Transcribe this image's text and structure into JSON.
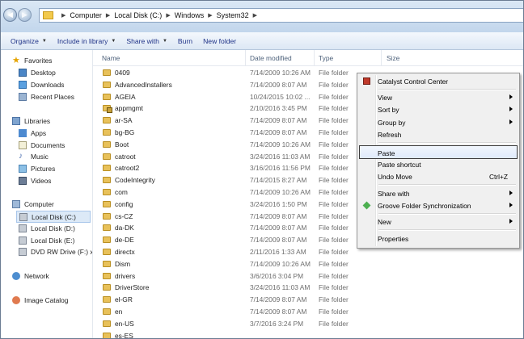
{
  "address": {
    "crumbs": [
      "Computer",
      "Local Disk (C:)",
      "Windows",
      "System32"
    ]
  },
  "toolbar": {
    "organize": "Organize",
    "include": "Include in library",
    "share": "Share with",
    "burn": "Burn",
    "new_folder": "New folder"
  },
  "nav": {
    "favorites": "Favorites",
    "desktop": "Desktop",
    "downloads": "Downloads",
    "recent": "Recent Places",
    "libraries": "Libraries",
    "apps": "Apps",
    "documents": "Documents",
    "music": "Music",
    "pictures": "Pictures",
    "videos": "Videos",
    "computer": "Computer",
    "disk_c": "Local Disk (C:)",
    "disk_d": "Local Disk (D:)",
    "disk_e": "Local Disk (E:)",
    "dvd": "DVD RW Drive (F:) xx",
    "network": "Network",
    "image_catalog": "Image Catalog"
  },
  "columns": {
    "name": "Name",
    "date": "Date modified",
    "type": "Type",
    "size": "Size"
  },
  "files": [
    {
      "name": "0409",
      "date": "7/14/2009 10:26 AM",
      "type": "File folder"
    },
    {
      "name": "AdvancedInstallers",
      "date": "7/14/2009 8:07 AM",
      "type": "File folder"
    },
    {
      "name": "AGEIA",
      "date": "10/24/2015 10:02 ...",
      "type": "File folder"
    },
    {
      "name": "appmgmt",
      "date": "2/10/2016 3:45 PM",
      "type": "File folder"
    },
    {
      "name": "ar-SA",
      "date": "7/14/2009 8:07 AM",
      "type": "File folder"
    },
    {
      "name": "bg-BG",
      "date": "7/14/2009 8:07 AM",
      "type": "File folder"
    },
    {
      "name": "Boot",
      "date": "7/14/2009 10:26 AM",
      "type": "File folder"
    },
    {
      "name": "catroot",
      "date": "3/24/2016 11:03 AM",
      "type": "File folder"
    },
    {
      "name": "catroot2",
      "date": "3/16/2016 11:56 PM",
      "type": "File folder"
    },
    {
      "name": "CodeIntegrity",
      "date": "7/14/2015 8:27 AM",
      "type": "File folder"
    },
    {
      "name": "com",
      "date": "7/14/2009 10:26 AM",
      "type": "File folder"
    },
    {
      "name": "config",
      "date": "3/24/2016 1:50 PM",
      "type": "File folder"
    },
    {
      "name": "cs-CZ",
      "date": "7/14/2009 8:07 AM",
      "type": "File folder"
    },
    {
      "name": "da-DK",
      "date": "7/14/2009 8:07 AM",
      "type": "File folder"
    },
    {
      "name": "de-DE",
      "date": "7/14/2009 8:07 AM",
      "type": "File folder"
    },
    {
      "name": "directx",
      "date": "2/11/2016 1:33 AM",
      "type": "File folder"
    },
    {
      "name": "Dism",
      "date": "7/14/2009 10:26 AM",
      "type": "File folder"
    },
    {
      "name": "drivers",
      "date": "3/6/2016 3:04 PM",
      "type": "File folder"
    },
    {
      "name": "DriverStore",
      "date": "3/24/2016 11:03 AM",
      "type": "File folder"
    },
    {
      "name": "el-GR",
      "date": "7/14/2009 8:07 AM",
      "type": "File folder"
    },
    {
      "name": "en",
      "date": "7/14/2009 8:07 AM",
      "type": "File folder"
    },
    {
      "name": "en-US",
      "date": "3/7/2016 3:24 PM",
      "type": "File folder"
    },
    {
      "name": "es-ES",
      "date": "",
      "type": ""
    }
  ],
  "menu": {
    "ccc": "Catalyst Control Center",
    "view": "View",
    "sort_by": "Sort by",
    "group_by": "Group by",
    "refresh": "Refresh",
    "paste": "Paste",
    "paste_shortcut": "Paste shortcut",
    "undo_move": "Undo Move",
    "undo_shortcut": "Ctrl+Z",
    "share_with": "Share with",
    "groove": "Groove Folder Synchronization",
    "new": "New",
    "properties": "Properties"
  }
}
